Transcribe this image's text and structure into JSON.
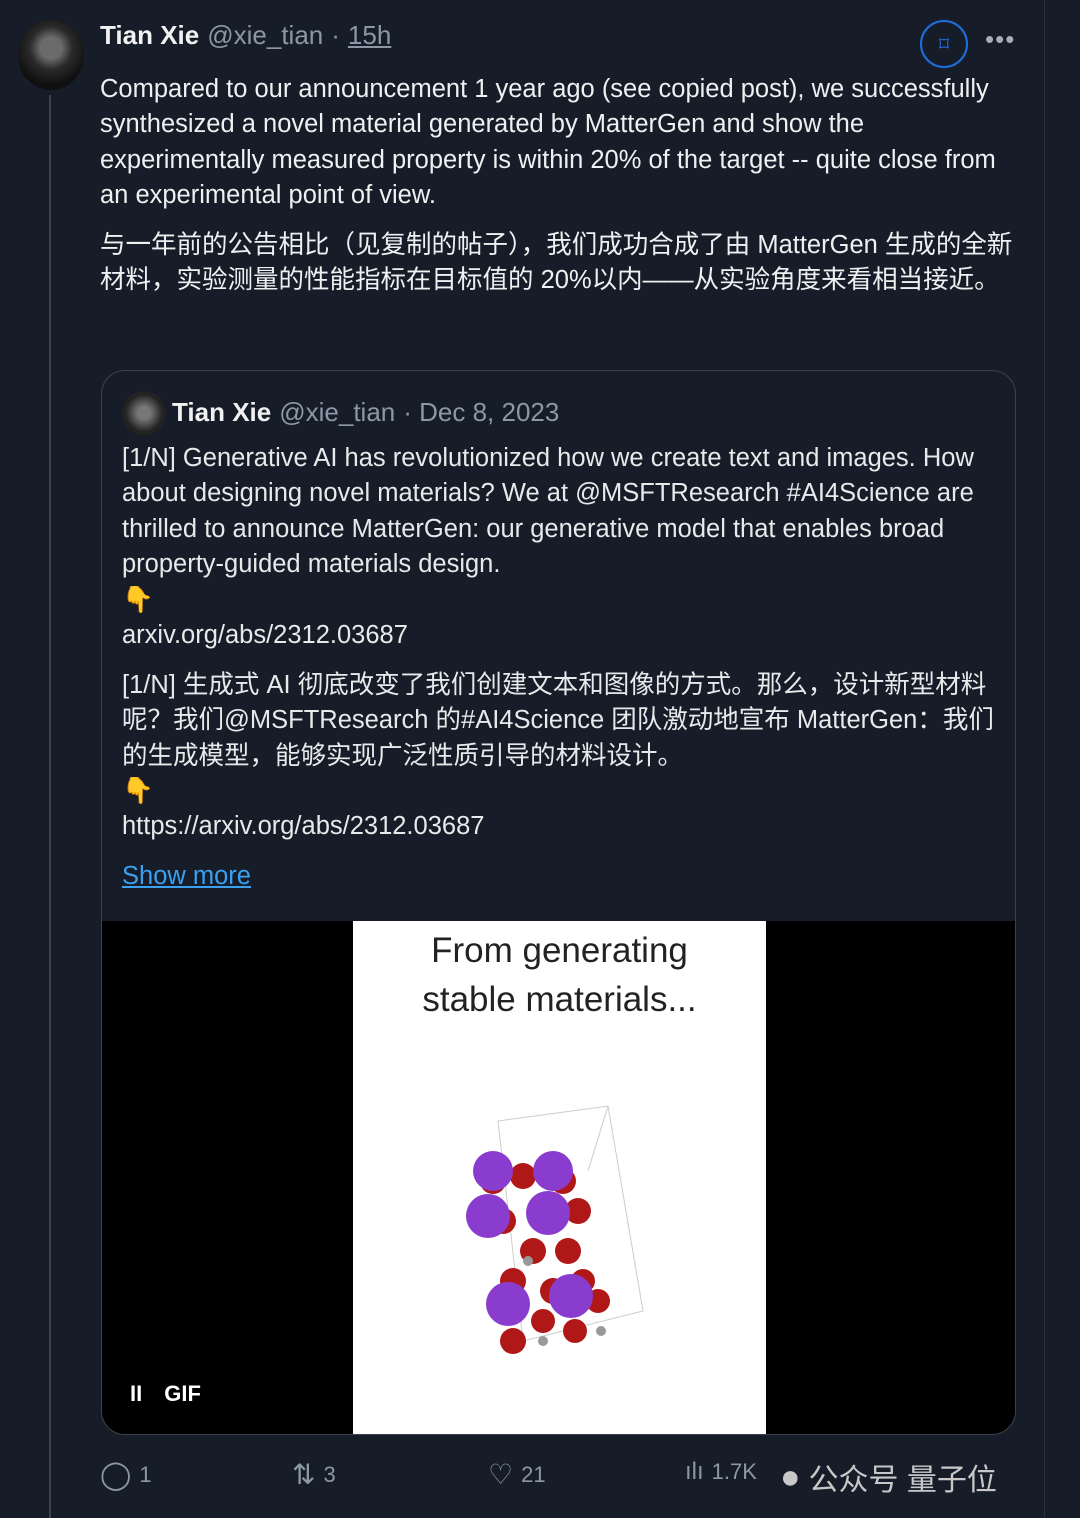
{
  "post": {
    "author": "Tian Xie",
    "handle": "@xie_tian",
    "sep": "·",
    "time": "15h",
    "text_en": "Compared to our announcement 1 year ago (see copied post), we successfully synthesized a novel material generated by MatterGen and show the experimentally measured property is within 20% of the target -- quite close from an experimental point of view.",
    "text_zh": "与一年前的公告相比（见复制的帖子），我们成功合成了由 MatterGen 生成的全新材料，实验测量的性能指标在目标值的 20%以内——从实验角度来看相当接近。"
  },
  "quote": {
    "author": "Tian Xie",
    "handle": "@xie_tian",
    "date": "· Dec 8, 2023",
    "text_en": "[1/N] Generative AI has revolutionized how we create text and images. How about designing novel materials? We at @MSFTResearch #AI4Science are thrilled to announce MatterGen: our generative model that enables broad property-guided materials design.",
    "emoji1": "👇",
    "link1": "arxiv.org/abs/2312.03687",
    "text_zh": "[1/N] 生成式 AI 彻底改变了我们创建文本和图像的方式。那么，设计新型材料呢？我们@MSFTResearch 的#AI4Science 团队激动地宣布 MatterGen：我们的生成模型，能够实现广泛性质引导的材料设计。",
    "emoji2": "👇",
    "link2": "https://arxiv.org/abs/2312.03687",
    "show_more": "Show more",
    "media": {
      "title_line1": "From generating",
      "title_line2": "stable materials...",
      "pause": "II",
      "badge": "GIF"
    }
  },
  "actions": {
    "replies": "1",
    "reposts": "3",
    "likes": "21",
    "views": "1.7K"
  },
  "watermark": "公众号 量子位",
  "colors": {
    "background": "#161d28",
    "accent": "#1d6fe0",
    "link": "#3aa0f0"
  }
}
